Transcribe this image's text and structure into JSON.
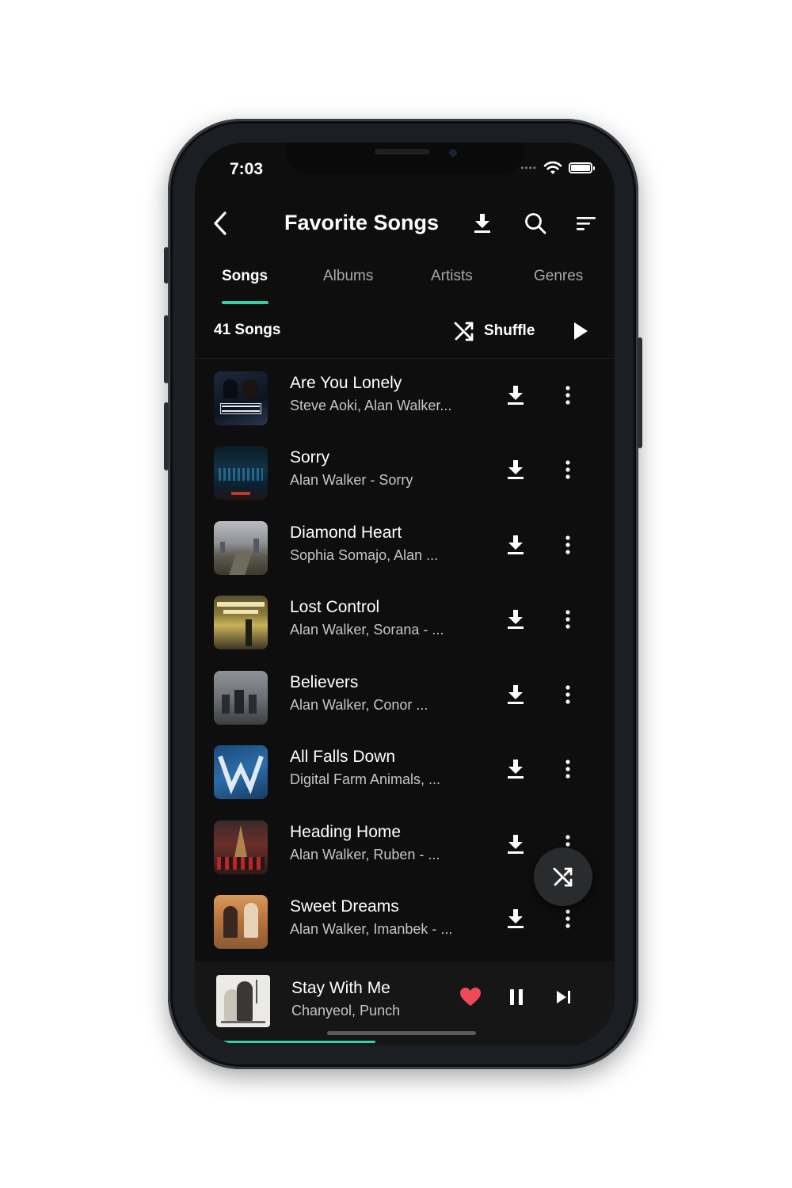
{
  "status_bar": {
    "time": "7:03"
  },
  "header": {
    "title": "Favorite Songs"
  },
  "tabs": [
    {
      "label": "Songs",
      "active": true
    },
    {
      "label": "Albums",
      "active": false
    },
    {
      "label": "Artists",
      "active": false
    },
    {
      "label": "Genres",
      "active": false
    }
  ],
  "controls": {
    "song_count": "41 Songs",
    "shuffle_label": "Shuffle"
  },
  "songs": [
    {
      "title": "Are You Lonely",
      "subtitle": "Steve Aoki, Alan Walker..."
    },
    {
      "title": "Sorry",
      "subtitle": "Alan Walker - Sorry"
    },
    {
      "title": "Diamond Heart",
      "subtitle": "Sophia Somajo, Alan ..."
    },
    {
      "title": "Lost Control",
      "subtitle": "Alan Walker, Sorana - ..."
    },
    {
      "title": "Believers",
      "subtitle": "Alan Walker, Conor ..."
    },
    {
      "title": "All Falls Down",
      "subtitle": "Digital Farm Animals, ..."
    },
    {
      "title": "Heading Home",
      "subtitle": "Alan Walker, Ruben - ..."
    },
    {
      "title": "Sweet Dreams",
      "subtitle": "Alan Walker, Imanbek - ..."
    }
  ],
  "now_playing": {
    "title": "Stay With Me",
    "subtitle": "Chanyeol, Punch",
    "liked": true,
    "progress": 0.42
  },
  "colors": {
    "accent": "#2fd3a6",
    "background": "#0e0e0f",
    "heart": "#ef4a57"
  }
}
